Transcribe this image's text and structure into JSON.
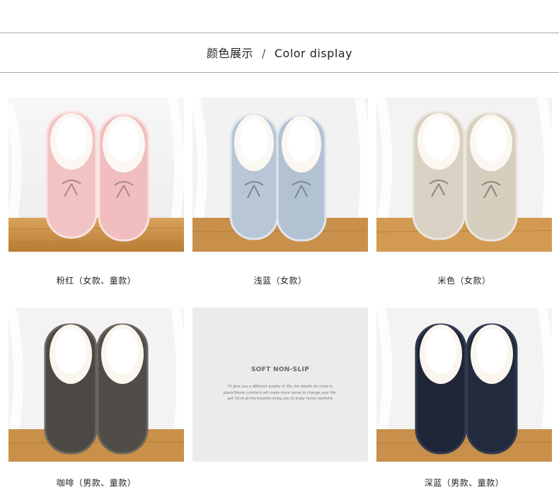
{
  "header": {
    "title_cn": "颜色展示",
    "separator": "/",
    "title_en": "Color display"
  },
  "products": [
    {
      "caption": "粉红（女款、童款）",
      "color": "#f2c2c4",
      "icon": "slipper-pink-bow"
    },
    {
      "caption": "浅蓝（女款）",
      "color": "#b9c8d8",
      "icon": "slipper-light-blue-bow"
    },
    {
      "caption": "米色（女款）",
      "color": "#d8d0c2",
      "icon": "slipper-beige-bow"
    },
    {
      "caption": "咖啡（男款、童款）",
      "color": "#4d4944",
      "icon": "slipper-coffee"
    },
    {
      "caption": "深蓝（男款、童款）",
      "color": "#1f2638",
      "icon": "slipper-navy"
    }
  ],
  "promo": {
    "title": "SOFT NON-SLIP",
    "text": "I'll give you a different quality of life, the details do more in place!Home comforts will make more sense to change your life, get rid of all the troubles bring you to enjoy home comforts"
  }
}
